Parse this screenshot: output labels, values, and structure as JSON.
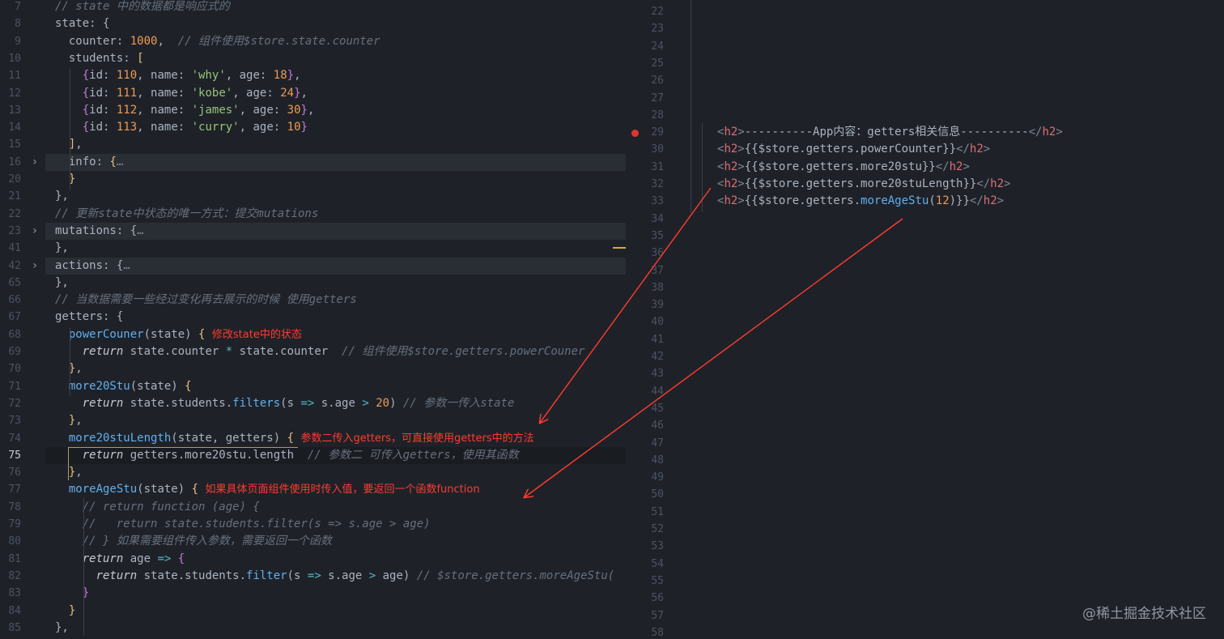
{
  "left_lines": [
    {
      "n": "7",
      "segs": [
        {
          "t": "// state 中的数据都是响应式的",
          "c": "c"
        }
      ]
    },
    {
      "n": "8",
      "segs": [
        {
          "t": "state: {"
        }
      ]
    },
    {
      "n": "9",
      "segs": [
        {
          "t": "  counter: "
        },
        {
          "t": "1000",
          "c": "n"
        },
        {
          "t": ",  "
        },
        {
          "t": "// 组件使用$store.state.counter",
          "c": "c"
        }
      ]
    },
    {
      "n": "10",
      "segs": [
        {
          "t": "  students: "
        },
        {
          "t": "[",
          "c": "y"
        }
      ]
    },
    {
      "n": "11",
      "segs": [
        {
          "t": "    "
        },
        {
          "t": "{",
          "c": "p"
        },
        {
          "t": "id: "
        },
        {
          "t": "110",
          "c": "n"
        },
        {
          "t": ", name: "
        },
        {
          "t": "'why'",
          "c": "s"
        },
        {
          "t": ", age: "
        },
        {
          "t": "18",
          "c": "n"
        },
        {
          "t": "}",
          "c": "p"
        },
        {
          "t": ","
        }
      ]
    },
    {
      "n": "12",
      "segs": [
        {
          "t": "    "
        },
        {
          "t": "{",
          "c": "p"
        },
        {
          "t": "id: "
        },
        {
          "t": "111",
          "c": "n"
        },
        {
          "t": ", name: "
        },
        {
          "t": "'kobe'",
          "c": "s"
        },
        {
          "t": ", age: "
        },
        {
          "t": "24",
          "c": "n"
        },
        {
          "t": "}",
          "c": "p"
        },
        {
          "t": ","
        }
      ]
    },
    {
      "n": "13",
      "segs": [
        {
          "t": "    "
        },
        {
          "t": "{",
          "c": "p"
        },
        {
          "t": "id: "
        },
        {
          "t": "112",
          "c": "n"
        },
        {
          "t": ", name: "
        },
        {
          "t": "'james'",
          "c": "s"
        },
        {
          "t": ", age: "
        },
        {
          "t": "30",
          "c": "n"
        },
        {
          "t": "}",
          "c": "p"
        },
        {
          "t": ","
        }
      ]
    },
    {
      "n": "14",
      "segs": [
        {
          "t": "    "
        },
        {
          "t": "{",
          "c": "p"
        },
        {
          "t": "id: "
        },
        {
          "t": "113",
          "c": "n"
        },
        {
          "t": ", name: "
        },
        {
          "t": "'curry'",
          "c": "s"
        },
        {
          "t": ", age: "
        },
        {
          "t": "10",
          "c": "n"
        },
        {
          "t": "}",
          "c": "p"
        }
      ]
    },
    {
      "n": "15",
      "segs": [
        {
          "t": "  "
        },
        {
          "t": "]",
          "c": "y"
        },
        {
          "t": ","
        }
      ]
    },
    {
      "n": "16",
      "fold": true,
      "hl": true,
      "segs": [
        {
          "t": "  info: "
        },
        {
          "t": "{",
          "c": "y"
        },
        {
          "t": "…",
          "c": "dim"
        }
      ]
    },
    {
      "n": "20",
      "segs": [
        {
          "t": "  "
        },
        {
          "t": "}",
          "c": "y"
        }
      ]
    },
    {
      "n": "21",
      "segs": [
        {
          "t": "},"
        }
      ]
    },
    {
      "n": "22",
      "segs": [
        {
          "t": "// 更新state中状态的唯一方式：提交mutations",
          "c": "c"
        }
      ]
    },
    {
      "n": "23",
      "fold": true,
      "hl": true,
      "segs": [
        {
          "t": "mutations: {"
        },
        {
          "t": "…",
          "c": "dim"
        }
      ]
    },
    {
      "n": "41",
      "segs": [
        {
          "t": "},"
        }
      ]
    },
    {
      "n": "42",
      "fold": true,
      "hl": true,
      "segs": [
        {
          "t": "actions: {"
        },
        {
          "t": "…",
          "c": "dim"
        }
      ]
    },
    {
      "n": "65",
      "segs": [
        {
          "t": "},"
        }
      ]
    },
    {
      "n": "66",
      "segs": [
        {
          "t": "// 当数据需要一些经过变化再去展示的时候 使用getters",
          "c": "c"
        }
      ]
    },
    {
      "n": "67",
      "segs": [
        {
          "t": "getters: {"
        }
      ]
    },
    {
      "n": "68",
      "segs": [
        {
          "t": "  "
        },
        {
          "t": "powerCouner",
          "c": "f"
        },
        {
          "t": "(state) "
        },
        {
          "t": "{",
          "c": "y"
        },
        {
          "t": " "
        },
        {
          "t": "修改state中的状态",
          "c": "an"
        }
      ]
    },
    {
      "n": "69",
      "segs": [
        {
          "t": "    "
        },
        {
          "t": "return",
          "c": "k"
        },
        {
          "t": " state.counter "
        },
        {
          "t": "*",
          "c": "o"
        },
        {
          "t": " state.counter  "
        },
        {
          "t": "// 组件使用$store.getters.powerCouner",
          "c": "c"
        }
      ]
    },
    {
      "n": "70",
      "segs": [
        {
          "t": "  "
        },
        {
          "t": "}",
          "c": "y"
        },
        {
          "t": ","
        }
      ]
    },
    {
      "n": "71",
      "segs": [
        {
          "t": "  "
        },
        {
          "t": "more20Stu",
          "c": "f"
        },
        {
          "t": "(state) "
        },
        {
          "t": "{",
          "c": "y"
        }
      ]
    },
    {
      "n": "72",
      "segs": [
        {
          "t": "    "
        },
        {
          "t": "return",
          "c": "k"
        },
        {
          "t": " state.students."
        },
        {
          "t": "filters",
          "c": "f"
        },
        {
          "t": "(s "
        },
        {
          "t": "=>",
          "c": "o"
        },
        {
          "t": " s.age "
        },
        {
          "t": ">",
          "c": "o"
        },
        {
          "t": " "
        },
        {
          "t": "20",
          "c": "n"
        },
        {
          "t": ") "
        },
        {
          "t": "// 参数一传入state",
          "c": "c"
        }
      ]
    },
    {
      "n": "73",
      "segs": [
        {
          "t": "  "
        },
        {
          "t": "}",
          "c": "y"
        },
        {
          "t": ","
        }
      ]
    },
    {
      "n": "74",
      "segs": [
        {
          "t": "  "
        },
        {
          "t": "more20stuLength",
          "c": "f"
        },
        {
          "t": "(state, getters) "
        },
        {
          "t": "{",
          "c": "y"
        },
        {
          "t": " "
        },
        {
          "t": "参数二传入getters，可直接使用getters中的方法",
          "c": "an"
        }
      ]
    },
    {
      "n": "75",
      "cur": true,
      "segs": [
        {
          "t": "    "
        },
        {
          "t": "return",
          "c": "k"
        },
        {
          "t": " getters.more20stu.length  "
        },
        {
          "t": "// 参数二 可传入getters，使用其函数",
          "c": "c"
        }
      ]
    },
    {
      "n": "76",
      "segs": [
        {
          "t": "  "
        },
        {
          "t": "}",
          "c": "y"
        },
        {
          "t": ","
        }
      ]
    },
    {
      "n": "77",
      "segs": [
        {
          "t": "  "
        },
        {
          "t": "moreAgeStu",
          "c": "f"
        },
        {
          "t": "(state) "
        },
        {
          "t": "{",
          "c": "y"
        },
        {
          "t": " "
        },
        {
          "t": "如果具体页面组件使用时传入值，要返回一个函数function",
          "c": "an"
        }
      ]
    },
    {
      "n": "78",
      "segs": [
        {
          "t": "    "
        },
        {
          "t": "// return function (age) {",
          "c": "c"
        }
      ]
    },
    {
      "n": "79",
      "segs": [
        {
          "t": "    "
        },
        {
          "t": "//   return state.students.filter(s => s.age > age)",
          "c": "c"
        }
      ]
    },
    {
      "n": "80",
      "segs": [
        {
          "t": "    "
        },
        {
          "t": "// } 如果需要组件传入参数，需要返回一个函数",
          "c": "c"
        }
      ]
    },
    {
      "n": "81",
      "segs": [
        {
          "t": "    "
        },
        {
          "t": "return",
          "c": "k"
        },
        {
          "t": " age "
        },
        {
          "t": "=>",
          "c": "o"
        },
        {
          "t": " "
        },
        {
          "t": "{",
          "c": "p"
        }
      ]
    },
    {
      "n": "82",
      "segs": [
        {
          "t": "      "
        },
        {
          "t": "return",
          "c": "k"
        },
        {
          "t": " state.students."
        },
        {
          "t": "filter",
          "c": "f"
        },
        {
          "t": "(s "
        },
        {
          "t": "=>",
          "c": "o"
        },
        {
          "t": " s.age "
        },
        {
          "t": ">",
          "c": "o"
        },
        {
          "t": " age) "
        },
        {
          "t": "// $store.getters.moreAgeStu(",
          "c": "c"
        }
      ]
    },
    {
      "n": "83",
      "segs": [
        {
          "t": "    "
        },
        {
          "t": "}",
          "c": "p"
        }
      ]
    },
    {
      "n": "84",
      "segs": [
        {
          "t": "  "
        },
        {
          "t": "}",
          "c": "y"
        }
      ]
    },
    {
      "n": "85",
      "segs": [
        {
          "t": "},"
        }
      ]
    }
  ],
  "right_lines": [
    {
      "n": "22",
      "segs": []
    },
    {
      "n": "23",
      "segs": []
    },
    {
      "n": "24",
      "segs": []
    },
    {
      "n": "25",
      "segs": []
    },
    {
      "n": "26",
      "segs": []
    },
    {
      "n": "27",
      "segs": []
    },
    {
      "n": "28",
      "segs": []
    },
    {
      "n": "29",
      "segs": [
        {
          "t": "<",
          "c": "dim"
        },
        {
          "t": "h2",
          "c": "tg"
        },
        {
          "t": ">",
          "c": "dim"
        },
        {
          "t": "----------App内容：getters相关信息----------"
        },
        {
          "t": "</",
          "c": "dim"
        },
        {
          "t": "h2",
          "c": "tg"
        },
        {
          "t": ">",
          "c": "dim"
        }
      ]
    },
    {
      "n": "30",
      "segs": [
        {
          "t": "<",
          "c": "dim"
        },
        {
          "t": "h2",
          "c": "tg"
        },
        {
          "t": ">",
          "c": "dim"
        },
        {
          "t": "{{$store.getters.powerCounter}}"
        },
        {
          "t": "</",
          "c": "dim"
        },
        {
          "t": "h2",
          "c": "tg"
        },
        {
          "t": ">",
          "c": "dim"
        }
      ]
    },
    {
      "n": "31",
      "segs": [
        {
          "t": "<",
          "c": "dim"
        },
        {
          "t": "h2",
          "c": "tg"
        },
        {
          "t": ">",
          "c": "dim"
        },
        {
          "t": "{{$store.getters.more20stu}}"
        },
        {
          "t": "</",
          "c": "dim"
        },
        {
          "t": "h2",
          "c": "tg"
        },
        {
          "t": ">",
          "c": "dim"
        }
      ]
    },
    {
      "n": "32",
      "segs": [
        {
          "t": "<",
          "c": "dim"
        },
        {
          "t": "h2",
          "c": "tg"
        },
        {
          "t": ">",
          "c": "dim"
        },
        {
          "t": "{{$store.getters.more20stuLength}}"
        },
        {
          "t": "</",
          "c": "dim"
        },
        {
          "t": "h2",
          "c": "tg"
        },
        {
          "t": ">",
          "c": "dim"
        }
      ]
    },
    {
      "n": "33",
      "segs": [
        {
          "t": "<",
          "c": "dim"
        },
        {
          "t": "h2",
          "c": "tg"
        },
        {
          "t": ">",
          "c": "dim"
        },
        {
          "t": "{{$store.getters."
        },
        {
          "t": "moreAgeStu",
          "c": "f"
        },
        {
          "t": "("
        },
        {
          "t": "12",
          "c": "n"
        },
        {
          "t": ")}}"
        },
        {
          "t": "</",
          "c": "dim"
        },
        {
          "t": "h2",
          "c": "tg"
        },
        {
          "t": ">",
          "c": "dim"
        }
      ]
    },
    {
      "n": "34",
      "segs": []
    },
    {
      "n": "35",
      "segs": []
    },
    {
      "n": "36",
      "segs": []
    },
    {
      "n": "37",
      "segs": []
    },
    {
      "n": "38",
      "segs": []
    },
    {
      "n": "39",
      "segs": []
    },
    {
      "n": "40",
      "segs": []
    },
    {
      "n": "41",
      "segs": []
    },
    {
      "n": "42",
      "segs": []
    },
    {
      "n": "43",
      "segs": []
    },
    {
      "n": "44",
      "segs": []
    },
    {
      "n": "45",
      "segs": []
    },
    {
      "n": "46",
      "segs": []
    },
    {
      "n": "47",
      "segs": []
    },
    {
      "n": "48",
      "segs": []
    },
    {
      "n": "49",
      "segs": []
    },
    {
      "n": "50",
      "segs": []
    },
    {
      "n": "51",
      "segs": []
    },
    {
      "n": "52",
      "segs": []
    },
    {
      "n": "53",
      "segs": []
    },
    {
      "n": "54",
      "segs": []
    },
    {
      "n": "55",
      "segs": []
    },
    {
      "n": "56",
      "segs": []
    },
    {
      "n": "57",
      "segs": []
    },
    {
      "n": "58",
      "segs": []
    }
  ],
  "watermark": "@稀土掘金技术社区",
  "colors": {
    "background": "#1e2228",
    "annotation": "#ff3b2f",
    "breakpoint": "#e5332d"
  }
}
